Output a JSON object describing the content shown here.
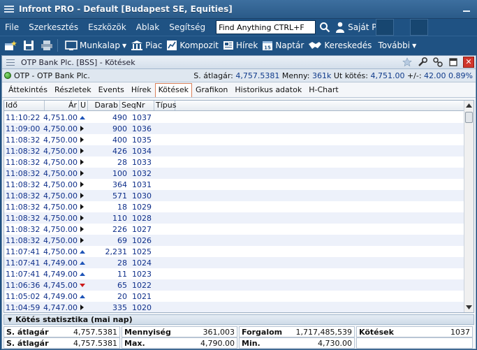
{
  "window": {
    "title": "Infront PRO - Default [Budapest SE, Equities]"
  },
  "menu": {
    "items": [
      "File",
      "Szerkesztés",
      "Eszközök",
      "Ablak",
      "Segítség"
    ],
    "search_value": "Find Anything CTRL+F",
    "profile_label": "Saját Profil"
  },
  "toolbar": {
    "buttons": [
      {
        "label": "Munkalap",
        "dropdown": true
      },
      {
        "label": "Piac",
        "dropdown": false
      },
      {
        "label": "Kompozit",
        "dropdown": false
      },
      {
        "label": "Hírek",
        "dropdown": false
      },
      {
        "label": "Naptár",
        "dropdown": false
      },
      {
        "label": "Kereskedés",
        "dropdown": false
      },
      {
        "label": "További",
        "dropdown": true
      }
    ]
  },
  "panel": {
    "title": "OTP Bank Plc. [BSS] - Kötések",
    "instrument": "OTP - OTP Bank Plc.",
    "stats": {
      "avg_label": "S. átlagár:",
      "avg_value": "4,757.5381",
      "vol_label": "Menny:",
      "vol_value": "361k",
      "last_label": "Ut kötés:",
      "last_value": "4,751.00",
      "chg_label": "+/-:",
      "chg_value": "42.00",
      "chg_pct": "0.89%"
    },
    "tabs": [
      "Áttekintés",
      "Részletek",
      "Events",
      "Hírek",
      "Kötések",
      "Grafikon",
      "Historikus adatok",
      "H-Chart"
    ],
    "active_tab": 4
  },
  "grid": {
    "columns": [
      "Idő",
      "Ár",
      "U",
      "Darab",
      "SeqNr",
      "Típus"
    ],
    "rows": [
      {
        "time": "11:10:22",
        "price": "4,751.00",
        "dir": "up",
        "qty": "490",
        "seq": "1037"
      },
      {
        "time": "11:09:00",
        "price": "4,750.00",
        "dir": "flat",
        "qty": "900",
        "seq": "1036"
      },
      {
        "time": "11:08:32",
        "price": "4,750.00",
        "dir": "flat",
        "qty": "400",
        "seq": "1035"
      },
      {
        "time": "11:08:32",
        "price": "4,750.00",
        "dir": "flat",
        "qty": "426",
        "seq": "1034"
      },
      {
        "time": "11:08:32",
        "price": "4,750.00",
        "dir": "flat",
        "qty": "28",
        "seq": "1033"
      },
      {
        "time": "11:08:32",
        "price": "4,750.00",
        "dir": "flat",
        "qty": "100",
        "seq": "1032"
      },
      {
        "time": "11:08:32",
        "price": "4,750.00",
        "dir": "flat",
        "qty": "364",
        "seq": "1031"
      },
      {
        "time": "11:08:32",
        "price": "4,750.00",
        "dir": "flat",
        "qty": "571",
        "seq": "1030"
      },
      {
        "time": "11:08:32",
        "price": "4,750.00",
        "dir": "flat",
        "qty": "18",
        "seq": "1029"
      },
      {
        "time": "11:08:32",
        "price": "4,750.00",
        "dir": "flat",
        "qty": "110",
        "seq": "1028"
      },
      {
        "time": "11:08:32",
        "price": "4,750.00",
        "dir": "flat",
        "qty": "226",
        "seq": "1027"
      },
      {
        "time": "11:08:32",
        "price": "4,750.00",
        "dir": "flat",
        "qty": "69",
        "seq": "1026"
      },
      {
        "time": "11:07:41",
        "price": "4,750.00",
        "dir": "up",
        "qty": "2,231",
        "seq": "1025"
      },
      {
        "time": "11:07:41",
        "price": "4,749.00",
        "dir": "up",
        "qty": "28",
        "seq": "1024"
      },
      {
        "time": "11:07:41",
        "price": "4,749.00",
        "dir": "up",
        "qty": "11",
        "seq": "1023"
      },
      {
        "time": "11:06:36",
        "price": "4,745.00",
        "dir": "down",
        "qty": "65",
        "seq": "1022"
      },
      {
        "time": "11:05:02",
        "price": "4,749.00",
        "dir": "up",
        "qty": "20",
        "seq": "1021"
      },
      {
        "time": "11:04:59",
        "price": "4,747.00",
        "dir": "flat",
        "qty": "335",
        "seq": "1020"
      }
    ]
  },
  "statistics": {
    "title": "Kötés statisztika (mai nap)",
    "rows": [
      [
        {
          "label": "S. átlagár",
          "value": "4,757.5381"
        },
        {
          "label": "Mennyiség",
          "value": "361,003"
        },
        {
          "label": "Forgalom",
          "value": "1,717,485,539"
        },
        {
          "label": "Kötések",
          "value": "1037"
        }
      ],
      [
        {
          "label": "S. átlagár",
          "value": "4,757.5381"
        },
        {
          "label": "Max.",
          "value": "4,790.00"
        },
        {
          "label": "Min.",
          "value": "4,730.00"
        },
        {
          "label": "",
          "value": ""
        }
      ]
    ]
  },
  "colors": {
    "chrome": "#1f5283",
    "value_text": "#0e2f8a",
    "up": "#1e54b8",
    "down": "#cc1a1a"
  }
}
